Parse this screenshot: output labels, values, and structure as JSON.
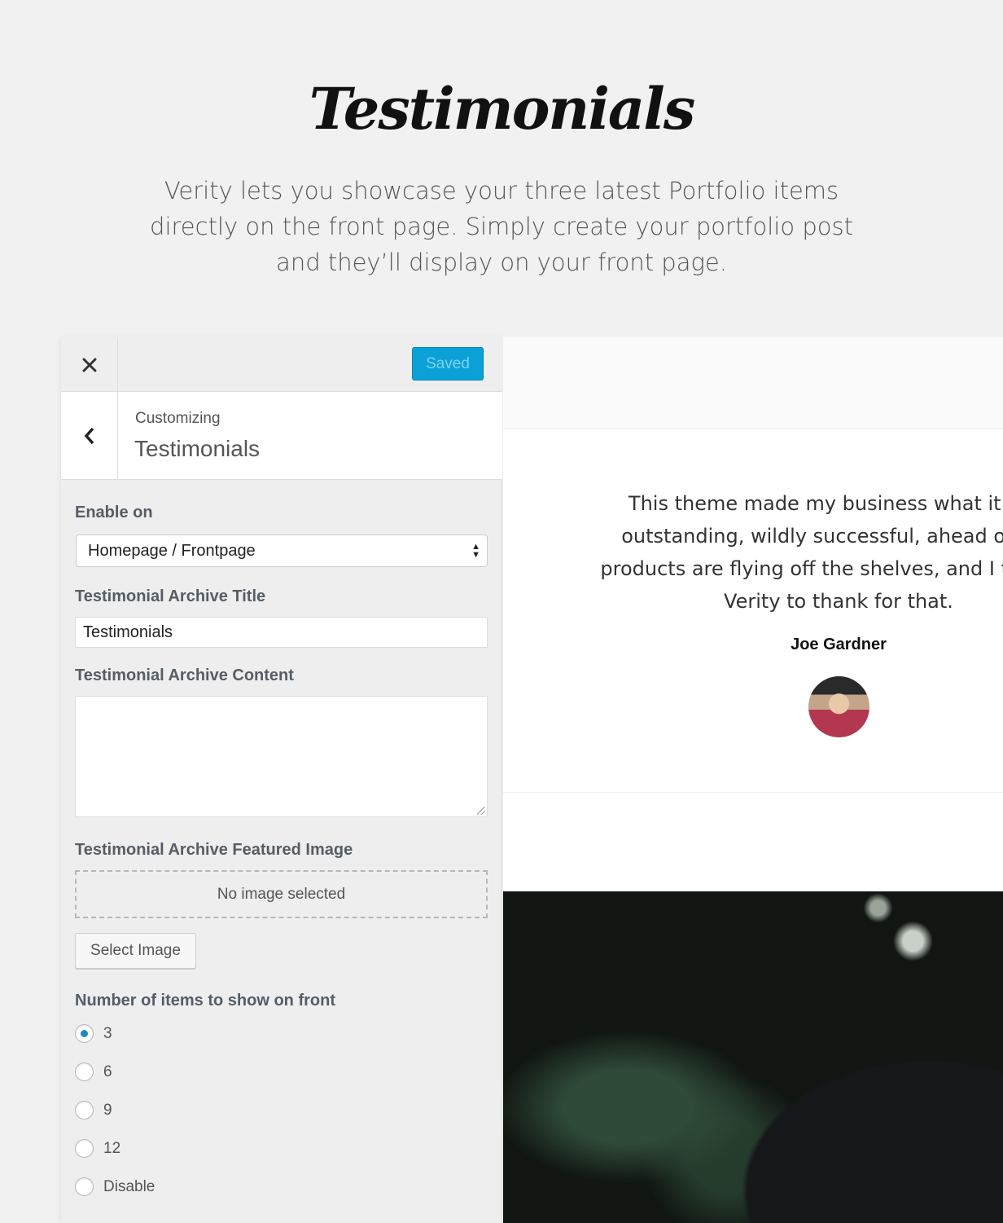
{
  "hero": {
    "title": "Testimonials",
    "description": "Verity lets you showcase your three latest Portfolio items directly on the front page. Simply create your portfolio post and they’ll display on your front page."
  },
  "customizer": {
    "close_icon": "close-icon",
    "saved_label": "Saved",
    "back_icon": "chevron-left-icon",
    "customizing_label": "Customizing",
    "section_name": "Testimonials",
    "enable_on": {
      "label": "Enable on",
      "selected": "Homepage / Frontpage"
    },
    "archive_title": {
      "label": "Testimonial Archive Title",
      "value": "Testimonials"
    },
    "archive_content": {
      "label": "Testimonial Archive Content",
      "value": ""
    },
    "featured_image": {
      "label": "Testimonial Archive Featured Image",
      "placeholder": "No image selected",
      "button_label": "Select Image"
    },
    "items_count": {
      "label": "Number of items to show on front",
      "options": [
        "3",
        "6",
        "9",
        "12",
        "Disable"
      ],
      "selected": "3"
    },
    "accent_color": "#0ba1d7"
  },
  "preview": {
    "quote": "This theme made my business what it is to\noutstanding, wildly successful, ahead of its t\nproducts are flying off the shelves, and I truly be\nVerity to thank for that.",
    "author": "Joe Gardner"
  }
}
